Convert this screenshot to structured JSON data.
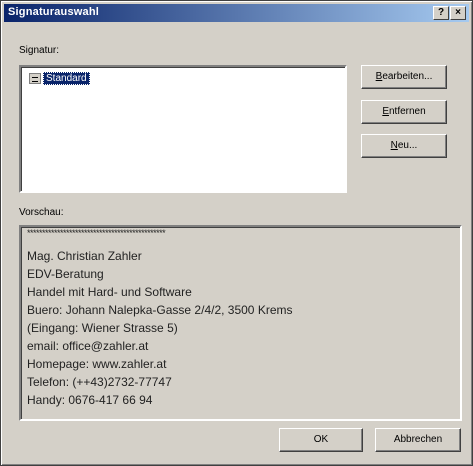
{
  "window": {
    "title": "Signaturauswahl",
    "help_button": "?",
    "close_button": "×"
  },
  "signature": {
    "label": "Signatur:",
    "items": [
      {
        "label": "Standard",
        "selected": true
      }
    ]
  },
  "buttons": {
    "edit": {
      "mnemonic": "B",
      "rest": "earbeiten..."
    },
    "remove": {
      "mnemonic": "E",
      "rest": "ntfernen"
    },
    "new": {
      "mnemonic": "N",
      "rest": "eu..."
    },
    "ok": "OK",
    "cancel": "Abbrechen"
  },
  "preview": {
    "label": "Vorschau:",
    "lines": [
      "**********************************************",
      "Mag. Christian Zahler",
      "EDV-Beratung",
      "Handel mit Hard- und Software",
      "Buero: Johann Nalepka-Gasse 2/4/2, 3500 Krems",
      "(Eingang: Wiener Strasse 5)",
      "email: office@zahler.at",
      "Homepage: www.zahler.at",
      "Telefon: (++43)2732-77747",
      "Handy: 0676-417 66 94"
    ]
  },
  "colors": {
    "titlebar_start": "#0a246a",
    "titlebar_end": "#a6caf0",
    "face": "#d4d0c8",
    "selection": "#0a246a"
  }
}
